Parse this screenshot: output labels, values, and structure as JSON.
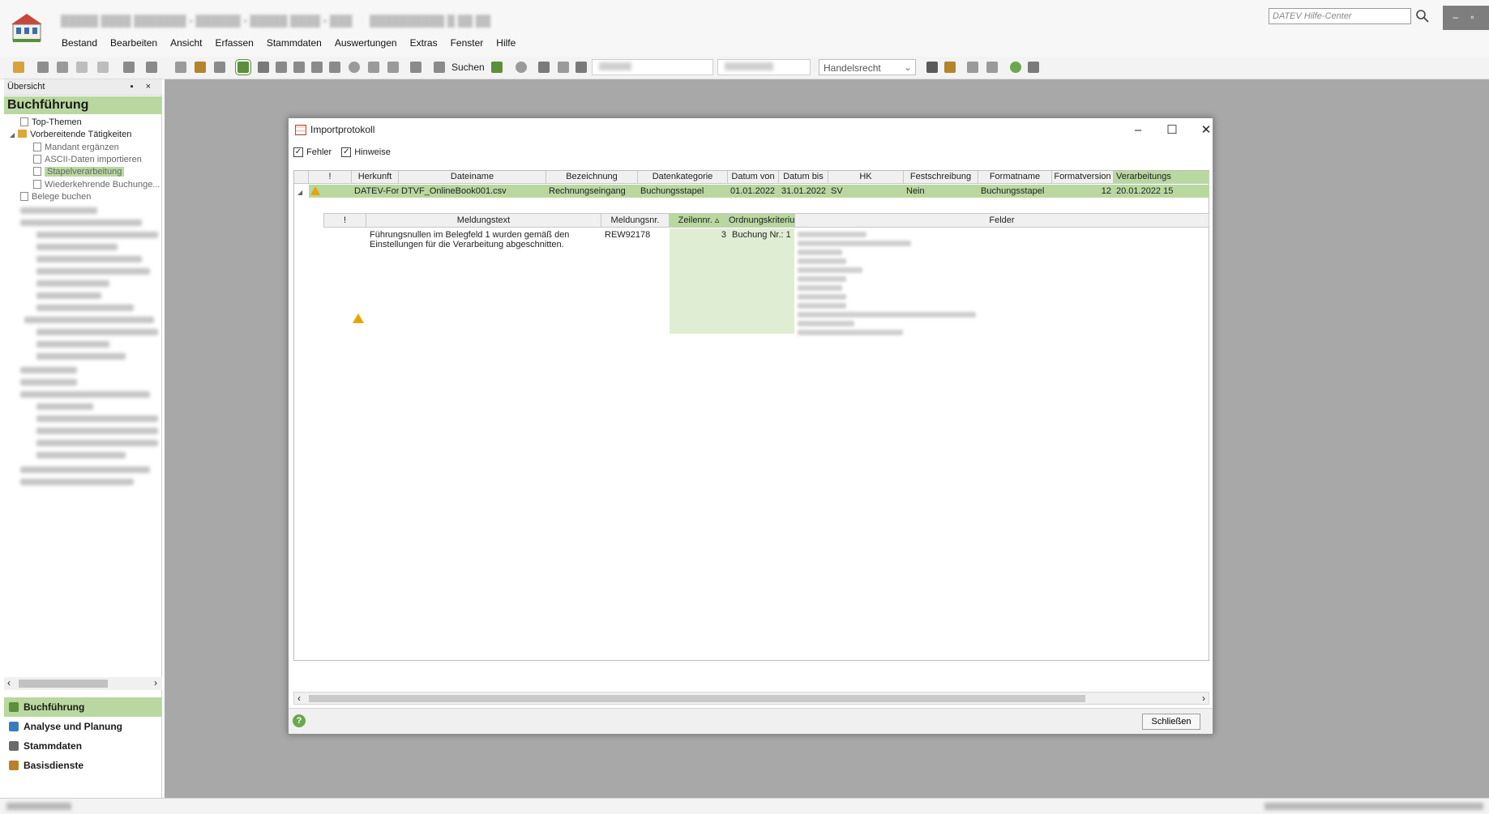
{
  "app": {
    "menu": [
      "Bestand",
      "Bearbeiten",
      "Ansicht",
      "Erfassen",
      "Stammdaten",
      "Auswertungen",
      "Extras",
      "Fenster",
      "Hilfe"
    ],
    "help_center_placeholder": "DATEV Hilfe-Center",
    "toolbar": {
      "search_label": "Suchen",
      "law_select": "Handelsrecht"
    }
  },
  "left_panel": {
    "header": "Übersicht",
    "title": "Buchführung",
    "tree": [
      {
        "label": "Top-Themen",
        "kind": "doc",
        "indent": 1
      },
      {
        "label": "Vorbereitende Tätigkeiten",
        "kind": "folder",
        "indent": 1
      },
      {
        "label": "Mandant ergänzen",
        "kind": "doc",
        "indent": 2
      },
      {
        "label": "ASCII-Daten importieren",
        "kind": "doc",
        "indent": 2
      },
      {
        "label": "Stapelverarbeitung",
        "kind": "doc",
        "indent": 2,
        "selected": true
      },
      {
        "label": "Wiederkehrende Buchunge...",
        "kind": "doc",
        "indent": 2
      },
      {
        "label": "Belege buchen",
        "kind": "doc",
        "indent": 1
      }
    ],
    "nav": [
      {
        "label": "Buchführung",
        "active": true,
        "color": "#5b8f3a"
      },
      {
        "label": "Analyse und Planung",
        "active": false,
        "color": "#3a7bbf"
      },
      {
        "label": "Stammdaten",
        "active": false,
        "color": "#6b6b6b"
      },
      {
        "label": "Basisdienste",
        "active": false,
        "color": "#b5832b"
      }
    ]
  },
  "dialog": {
    "title": "Importprotokoll",
    "filters": {
      "errors": "Fehler",
      "hints": "Hinweise"
    },
    "columns": [
      "!",
      "Herkunft",
      "Dateiname",
      "Bezeichnung",
      "Datenkategorie",
      "Datum von",
      "Datum bis",
      "HK",
      "Festschreibung",
      "Formatname",
      "Formatversion",
      "Verarbeitungs"
    ],
    "row": {
      "herkunft": "DATEV-For...",
      "dateiname": "DTVF_OnlineBook001.csv",
      "bezeichnung": "Rechnungseingang",
      "datenkategorie": "Buchungsstapel",
      "datum_von": "01.01.2022",
      "datum_bis": "31.01.2022",
      "hk": "SV",
      "festschreibung": "Nein",
      "formatname": "Buchungsstapel",
      "formatversion": "12",
      "verarbeitung": "20.01.2022 15"
    },
    "detail_columns": [
      "!",
      "Meldungstext",
      "Meldungsnr.",
      "Zeilennr.",
      "Ordnungskriterium",
      "Felder"
    ],
    "detail_row": {
      "text_line1": "Führungsnullen im Belegfeld 1 wurden gemäß den",
      "text_line2": "Einstellungen für die Verarbeitung abgeschnitten.",
      "nr": "REW92178",
      "zeile": "3",
      "kriterium": "Buchung Nr.: 1"
    },
    "close_label": "Schließen"
  },
  "colors": {
    "accent_green": "#b8d89f",
    "warning": "#e8a400"
  }
}
